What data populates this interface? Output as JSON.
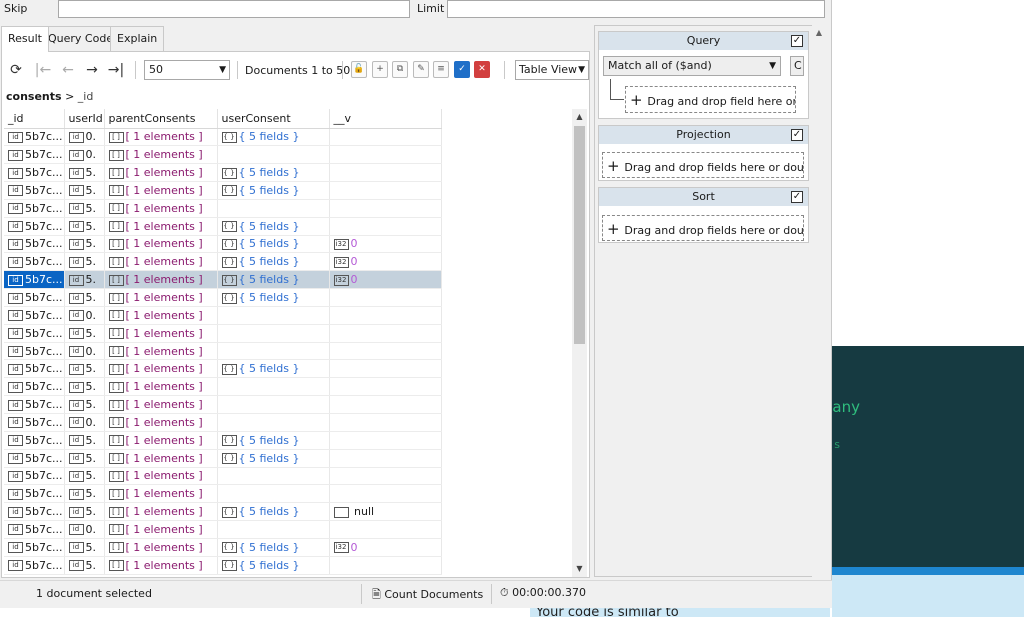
{
  "filter": {
    "skip_label": "Skip",
    "limit_label": "Limit",
    "skip_value": "",
    "limit_value": ""
  },
  "tabs": [
    {
      "label": "Result"
    },
    {
      "label": "Query Code"
    },
    {
      "label": "Explain"
    }
  ],
  "toolbar": {
    "page_size": "50",
    "doc_range": "Documents 1 to 50",
    "view_mode": "Table View"
  },
  "breadcrumb": {
    "collection": "consents",
    "field": "_id"
  },
  "table": {
    "columns": [
      "_id",
      "userId",
      "parentConsents",
      "userConsent",
      "__v"
    ],
    "rows": [
      {
        "id": "5b7c...",
        "uid": "0.",
        "pc": "[ 1 elements ]",
        "uc": "{ 5 fields }",
        "v": ""
      },
      {
        "id": "5b7c...",
        "uid": "0.",
        "pc": "[ 1 elements ]",
        "uc": "",
        "v": ""
      },
      {
        "id": "5b7c...",
        "uid": "5.",
        "pc": "[ 1 elements ]",
        "uc": "{ 5 fields }",
        "v": ""
      },
      {
        "id": "5b7c...",
        "uid": "5.",
        "pc": "[ 1 elements ]",
        "uc": "{ 5 fields }",
        "v": ""
      },
      {
        "id": "5b7c...",
        "uid": "5.",
        "pc": "[ 1 elements ]",
        "uc": "",
        "v": ""
      },
      {
        "id": "5b7c...",
        "uid": "5.",
        "pc": "[ 1 elements ]",
        "uc": "{ 5 fields }",
        "v": ""
      },
      {
        "id": "5b7c...",
        "uid": "5.",
        "pc": "[ 1 elements ]",
        "uc": "{ 5 fields }",
        "v": "0"
      },
      {
        "id": "5b7c...",
        "uid": "5.",
        "pc": "[ 1 elements ]",
        "uc": "{ 5 fields }",
        "v": "0"
      },
      {
        "id": "5b7c...",
        "uid": "5.",
        "pc": "[ 1 elements ]",
        "uc": "{ 5 fields }",
        "v": "0"
      },
      {
        "id": "5b7c...",
        "uid": "5.",
        "pc": "[ 1 elements ]",
        "uc": "{ 5 fields }",
        "v": ""
      },
      {
        "id": "5b7c...",
        "uid": "0.",
        "pc": "[ 1 elements ]",
        "uc": "",
        "v": ""
      },
      {
        "id": "5b7c...",
        "uid": "5.",
        "pc": "[ 1 elements ]",
        "uc": "",
        "v": ""
      },
      {
        "id": "5b7c...",
        "uid": "0.",
        "pc": "[ 1 elements ]",
        "uc": "",
        "v": ""
      },
      {
        "id": "5b7c...",
        "uid": "5.",
        "pc": "[ 1 elements ]",
        "uc": "{ 5 fields }",
        "v": ""
      },
      {
        "id": "5b7c...",
        "uid": "5.",
        "pc": "[ 1 elements ]",
        "uc": "",
        "v": ""
      },
      {
        "id": "5b7c...",
        "uid": "5.",
        "pc": "[ 1 elements ]",
        "uc": "",
        "v": ""
      },
      {
        "id": "5b7c...",
        "uid": "0.",
        "pc": "[ 1 elements ]",
        "uc": "",
        "v": ""
      },
      {
        "id": "5b7c...",
        "uid": "5.",
        "pc": "[ 1 elements ]",
        "uc": "{ 5 fields }",
        "v": ""
      },
      {
        "id": "5b7c...",
        "uid": "5.",
        "pc": "[ 1 elements ]",
        "uc": "{ 5 fields }",
        "v": ""
      },
      {
        "id": "5b7c...",
        "uid": "5.",
        "pc": "[ 1 elements ]",
        "uc": "",
        "v": ""
      },
      {
        "id": "5b7c...",
        "uid": "5.",
        "pc": "[ 1 elements ]",
        "uc": "",
        "v": ""
      },
      {
        "id": "5b7c...",
        "uid": "5.",
        "pc": "[ 1 elements ]",
        "uc": "{ 5 fields }",
        "v": "null"
      },
      {
        "id": "5b7c...",
        "uid": "0.",
        "pc": "[ 1 elements ]",
        "uc": "",
        "v": ""
      },
      {
        "id": "5b7c...",
        "uid": "5.",
        "pc": "[ 1 elements ]",
        "uc": "{ 5 fields }",
        "v": "0"
      },
      {
        "id": "5b7c...",
        "uid": "5.",
        "pc": "[ 1 elements ]",
        "uc": "{ 5 fields }",
        "v": ""
      }
    ],
    "selected_row": 8
  },
  "panels": {
    "query": {
      "title": "Query",
      "match": "Match all of ($and)",
      "extra": "C",
      "drop": "Drag and drop field here or do"
    },
    "projection": {
      "title": "Projection",
      "drop": "Drag and drop fields here or double-"
    },
    "sort": {
      "title": "Sort",
      "drop": "Drag and drop fields here or double-"
    }
  },
  "status": {
    "selection": "1 document selected",
    "count_label": "Count Documents",
    "elapsed": "00:00:00.370"
  },
  "background": {
    "text1": "any",
    "text2": "s",
    "bottom_text": "Your code is similar to"
  }
}
